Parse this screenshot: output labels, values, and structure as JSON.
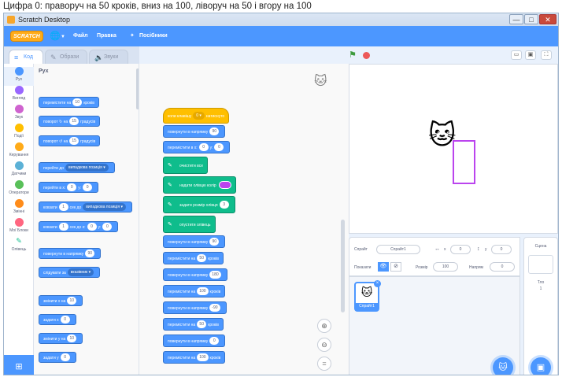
{
  "caption": "Цифра 0: праворуч на 50 кроків, вниз на 100, ліворуч на 50 і вгору на 100",
  "window": {
    "title": "Scratch Desktop",
    "controls": {
      "minimize": "—",
      "maximize": "□",
      "close": "✕"
    }
  },
  "menubar": {
    "logo": "SCRATCH",
    "language_icon": "🌐",
    "language_caret": "▼",
    "file": "Файл",
    "edit": "Правка",
    "tutorials": "Посібники",
    "tutorials_icon": "✦"
  },
  "tabs": [
    {
      "label": "Код",
      "icon": "≡"
    },
    {
      "label": "Образи",
      "icon": "✎"
    },
    {
      "label": "Звуки",
      "icon": "🔈"
    }
  ],
  "stage_controls": {
    "flag": "⚑",
    "small": "▭",
    "normal": "▣",
    "full": "⛶"
  },
  "categories": [
    {
      "label": "Рух",
      "color": "#4c97ff"
    },
    {
      "label": "Вигляд",
      "color": "#9966ff"
    },
    {
      "label": "Звук",
      "color": "#cf63cf"
    },
    {
      "label": "Події",
      "color": "#ffbf00"
    },
    {
      "label": "Керування",
      "color": "#ffab19"
    },
    {
      "label": "Датчики",
      "color": "#5cb1d6"
    },
    {
      "label": "Оператори",
      "color": "#59c059"
    },
    {
      "label": "Змінні",
      "color": "#ff8c1a"
    },
    {
      "label": "Мої Блоки",
      "color": "#ff6680"
    },
    {
      "label": "Олівець",
      "color": "#0fbd8c"
    }
  ],
  "extension_icon": "⊞",
  "palette": {
    "title": "Рух",
    "blocks": {
      "move_a": "перемістити на",
      "move_v": "10",
      "move_b": "кроків",
      "turn_r_a": "поворот",
      "turn_r_icon": "↻",
      "turn_r_b": "на",
      "turn_r_v": "15",
      "turn_r_c": "градусів",
      "turn_l_a": "поворот",
      "turn_l_icon": "↺",
      "turn_l_b": "на",
      "turn_l_v": "15",
      "turn_l_c": "градусів",
      "goto_a": "перейти до",
      "goto_dd": "випадкова позиція ▾",
      "gotoxy_a": "перейти в x:",
      "gotoxy_x": "0",
      "gotoxy_b": "y:",
      "gotoxy_y": "0",
      "glide_a": "ковзати",
      "glide_v": "1",
      "glide_b": "сек до",
      "glide_dd": "випадкова позиція ▾",
      "glidexy_a": "ковзати",
      "glidexy_v": "1",
      "glidexy_b": "сек до x:",
      "glidexy_x": "0",
      "glidexy_c": "y:",
      "glidexy_y": "0",
      "point_a": "повернути в напрямку",
      "point_v": "90",
      "pointto_a": "слідувати за",
      "pointto_dd": "вказівник ▾",
      "changex_a": "змінити х на",
      "changex_v": "10",
      "setx_a": "задати х",
      "setx_v": "0",
      "changey_a": "змінити у на",
      "changey_v": "10",
      "sety_a": "задати у",
      "sety_v": "0"
    }
  },
  "script": {
    "hat_a": "коли клавішу",
    "hat_dd": "0 ▾",
    "hat_b": "натиснуто",
    "s1_a": "повернути в напрямку",
    "s1_v": "90",
    "s2_a": "перемістити в х:",
    "s2_x": "0",
    "s2_b": "у:",
    "s2_y": "0",
    "pen_icon": "✎",
    "p1": "очистити все",
    "p2": "надати олівцю колір",
    "p3_a": "задати розмір олівця",
    "p3_v": "3",
    "p4": "опустити олівець",
    "m1_a": "повернути в напрямку",
    "m1_v": "90",
    "m2_a": "перемістити на",
    "m2_v": "50",
    "m2_b": "кроків",
    "m3_a": "повернути в напрямку",
    "m3_v": "180",
    "m4_a": "перемістити на",
    "m4_v": "100",
    "m4_b": "кроків",
    "m5_a": "повернути в напрямку",
    "m5_v": "-90",
    "m6_a": "перемістити на",
    "m6_v": "50",
    "m6_b": "кроків",
    "m7_a": "повернути в напрямку",
    "m7_v": "0",
    "m8_a": "перемістити на",
    "m8_v": "100",
    "m8_b": "кроків"
  },
  "zoom": {
    "in": "⊕",
    "out": "⊖",
    "reset": "="
  },
  "sprite_info": {
    "sprite_label": "Спрайт",
    "sprite_name": "Спрайт1",
    "x_icon": "↔",
    "x_label": "x",
    "x_value": "0",
    "y_icon": "↕",
    "y_label": "y",
    "y_value": "0",
    "show_label": "Показати",
    "show_on": "👁",
    "show_off": "⊘",
    "size_label": "Розмір",
    "size_value": "100",
    "direction_label": "Напрям",
    "direction_value": "0"
  },
  "sprite_list": {
    "thumb_name": "Спрайт1",
    "delete_icon": "×"
  },
  "stage_panel": {
    "title": "Сцена",
    "backdrops_label": "Тло",
    "backdrops_count": "1"
  },
  "fab": {
    "sprite_icon": "🐱",
    "backdrop_icon": "▣"
  },
  "colors": {
    "motion": "#4c97ff",
    "events": "#ffbf00",
    "pen": "#0fbd8c",
    "pen_color": "#bb44ee"
  }
}
